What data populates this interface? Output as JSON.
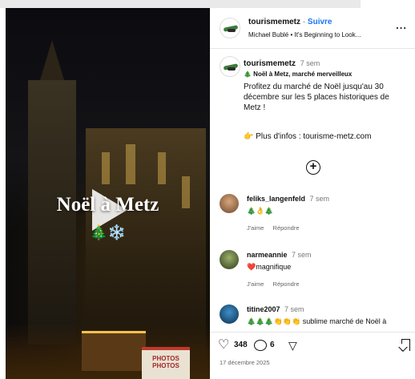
{
  "video": {
    "title": "Noël à Metz",
    "emoji": "🎄❄️",
    "sign_text": "PHOTOS PHOTOS"
  },
  "header": {
    "username": "tourismemetz",
    "separator": "·",
    "follow_label": "Suivre",
    "music": "Michael Bublé • It's Beginning to Look...",
    "more": "..."
  },
  "caption": {
    "username": "tourismemetz",
    "time": "7 sem",
    "headline": "🎄 Noël à Metz, marché merveilleux",
    "body": "Profitez du marché de Noël jusqu'au 30 décembre sur les 5 places historiques de Metz !",
    "link": "👉 Plus d'infos : tourisme-metz.com"
  },
  "comments": [
    {
      "username": "feliks_langenfeld",
      "time": "7 sem",
      "text": "🎄👌🎄",
      "like": "J'aime",
      "reply": "Répondre"
    },
    {
      "username": "narmeannie",
      "time": "7 sem",
      "text": "❤️magnifique",
      "like": "J'aime",
      "reply": "Répondre"
    },
    {
      "username": "titine2007",
      "time": "7 sem",
      "text": "🎄🎄🎄👏👏👏 sublime marché de Noël à"
    }
  ],
  "footer": {
    "likes": "348",
    "comments": "6",
    "date": "17 décembre 2025"
  },
  "icons": [
    "play-icon",
    "more-icon",
    "add-comment-icon",
    "heart-icon",
    "comment-icon",
    "share-icon",
    "bookmark-icon"
  ]
}
